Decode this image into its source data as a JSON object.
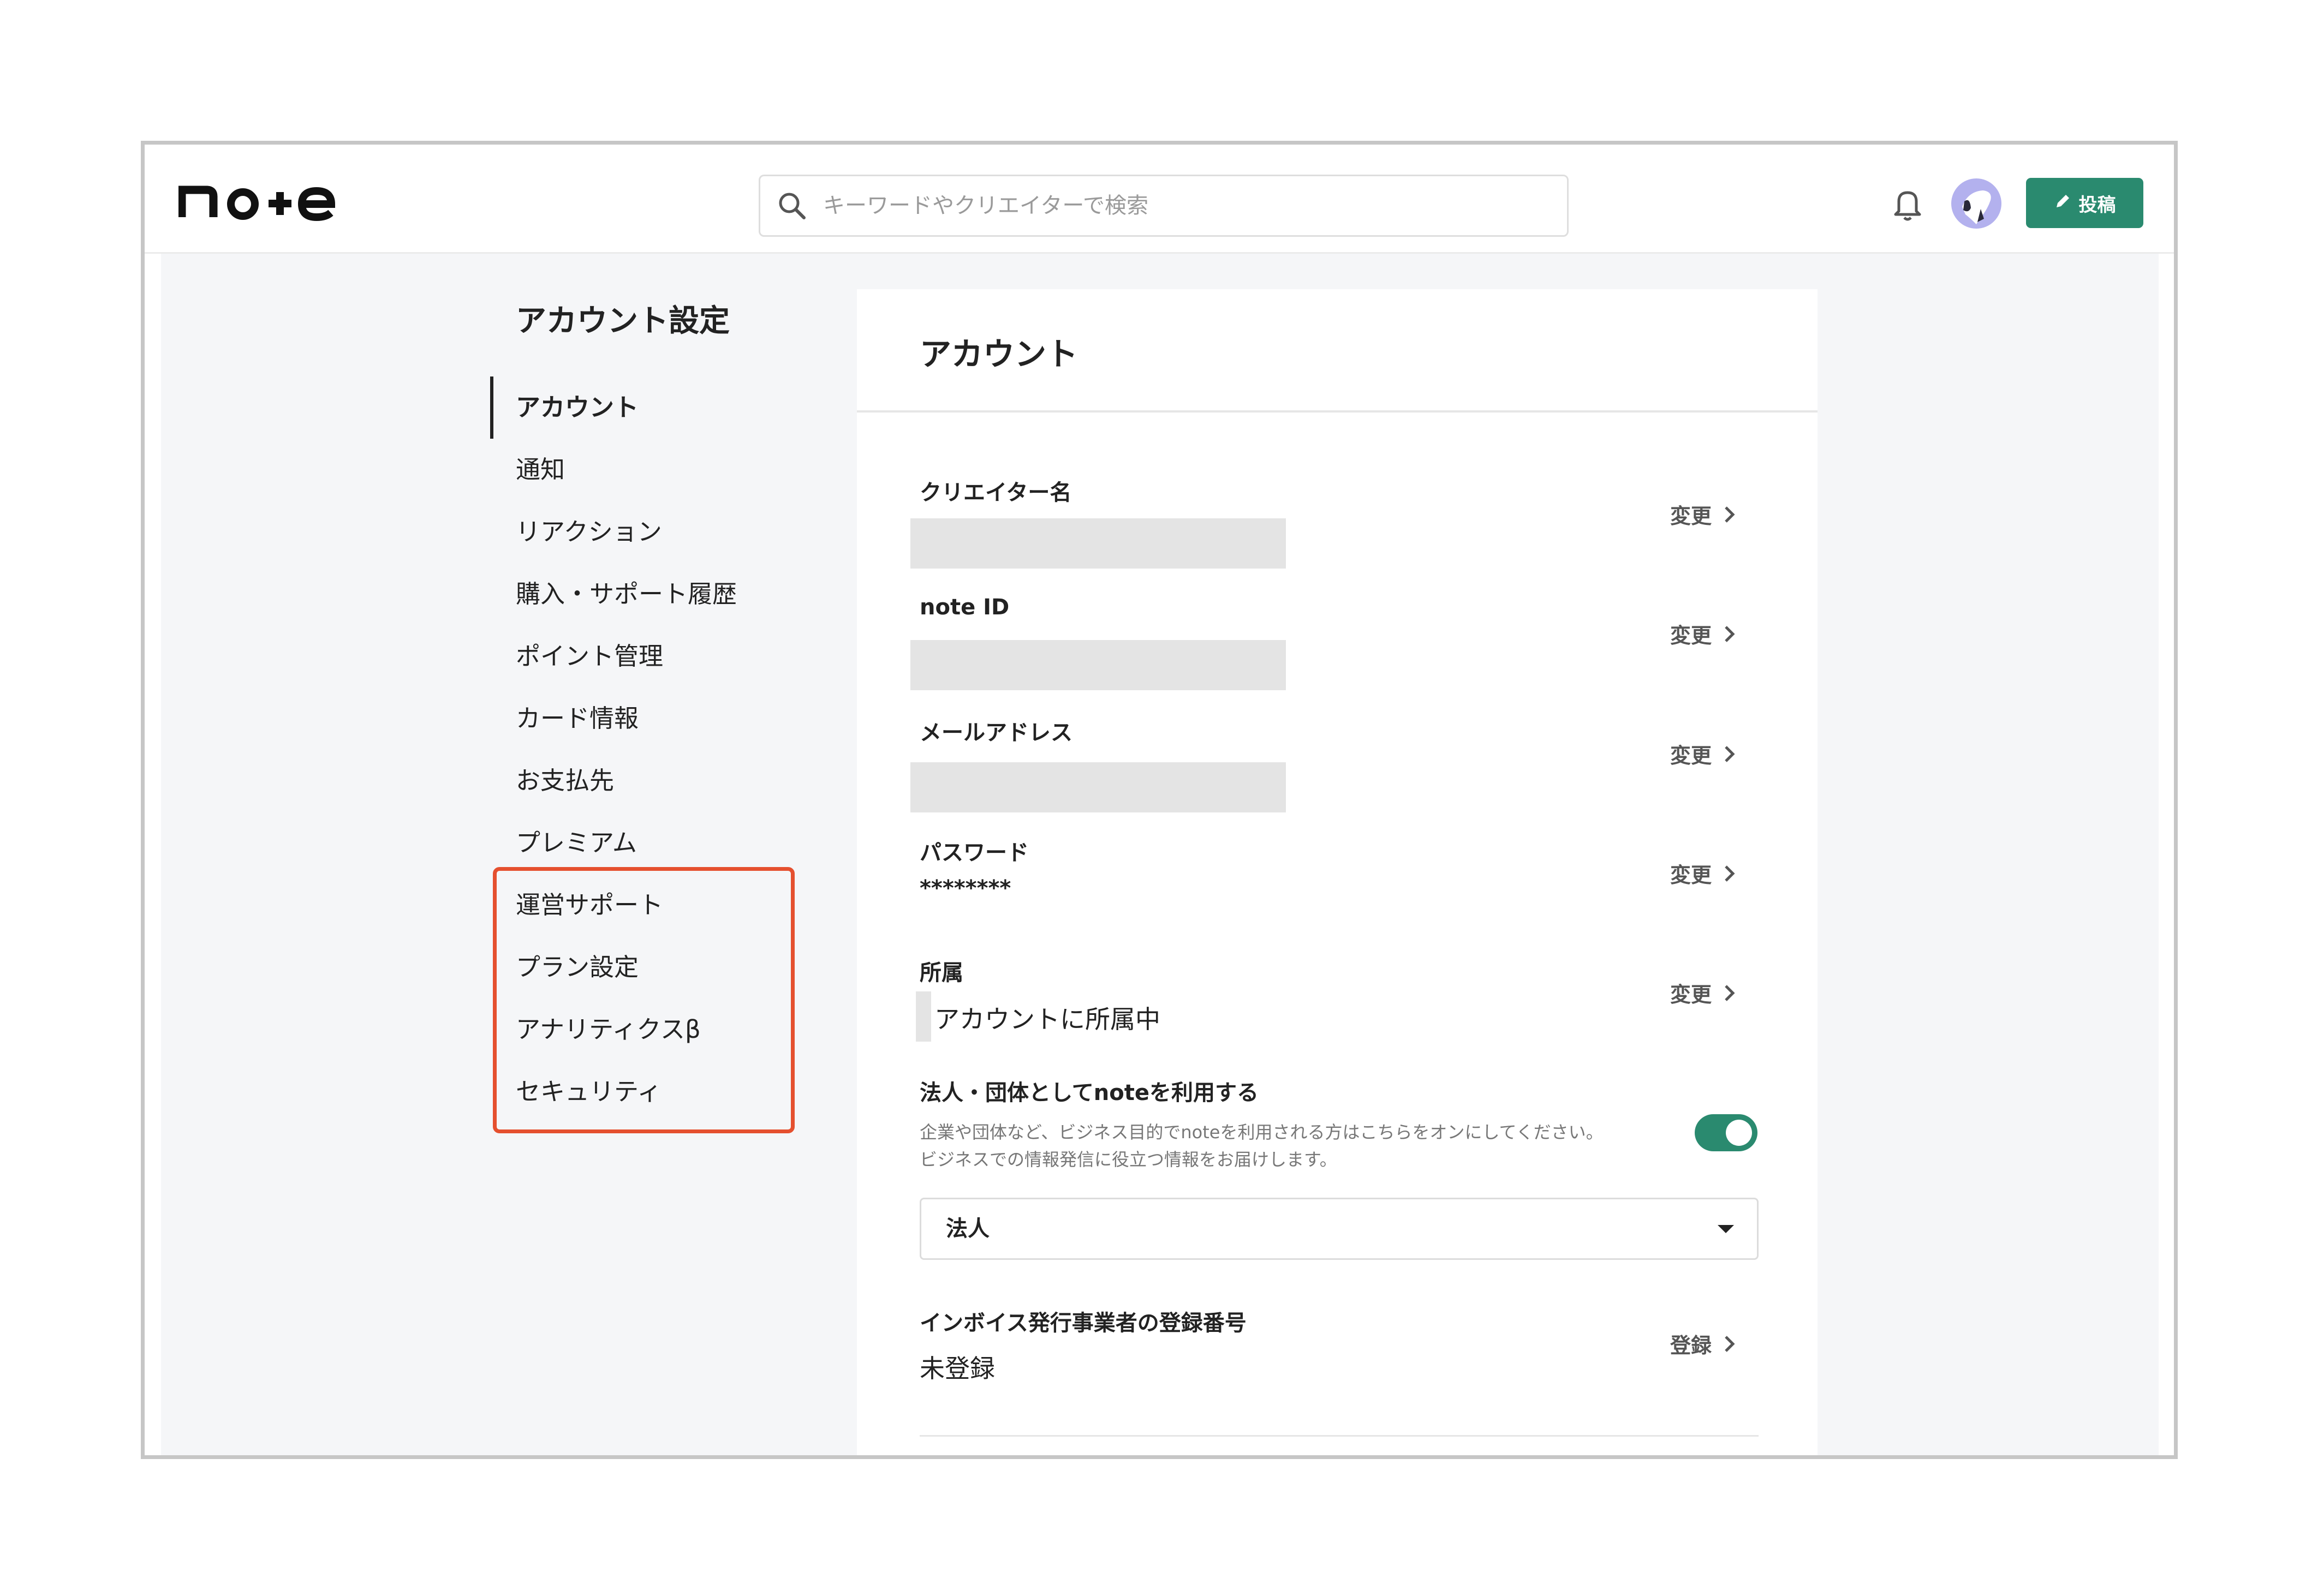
{
  "header": {
    "logo_text": "note",
    "search_placeholder": "キーワードやクリエイターで検索",
    "post_button_label": "投稿"
  },
  "sidebar": {
    "title": "アカウント設定",
    "items": [
      {
        "label": "アカウント",
        "active": true
      },
      {
        "label": "通知"
      },
      {
        "label": "リアクション"
      },
      {
        "label": "購入・サポート履歴"
      },
      {
        "label": "ポイント管理"
      },
      {
        "label": "カード情報"
      },
      {
        "label": "お支払先"
      },
      {
        "label": "プレミアム"
      },
      {
        "label": "運営サポート"
      },
      {
        "label": "プラン設定"
      },
      {
        "label": "アナリティクスβ"
      },
      {
        "label": "セキュリティ"
      }
    ]
  },
  "main": {
    "title": "アカウント",
    "fields": [
      {
        "label": "クリエイター名",
        "action": "変更"
      },
      {
        "label": "note ID",
        "action": "変更"
      },
      {
        "label": "メールアドレス",
        "action": "変更"
      },
      {
        "label": "パスワード",
        "value": "********",
        "action": "変更"
      },
      {
        "label": "所属",
        "value": "アカウントに所属中",
        "action": "変更"
      }
    ],
    "corporate": {
      "title": "法人・団体としてnoteを利用する",
      "description_line1": "企業や団体など、ビジネス目的でnoteを利用される方はこちらをオンにしてください。",
      "description_line2": "ビジネスでの情報発信に役立つ情報をお届けします。",
      "toggle_on": true,
      "select_value": "法人"
    },
    "invoice": {
      "label": "インボイス発行事業者の登録番号",
      "value": "未登録",
      "action": "登録"
    }
  },
  "colors": {
    "accent": "#2a8a6f",
    "highlight_border": "#e5502f",
    "background": "#f5f6f8"
  }
}
